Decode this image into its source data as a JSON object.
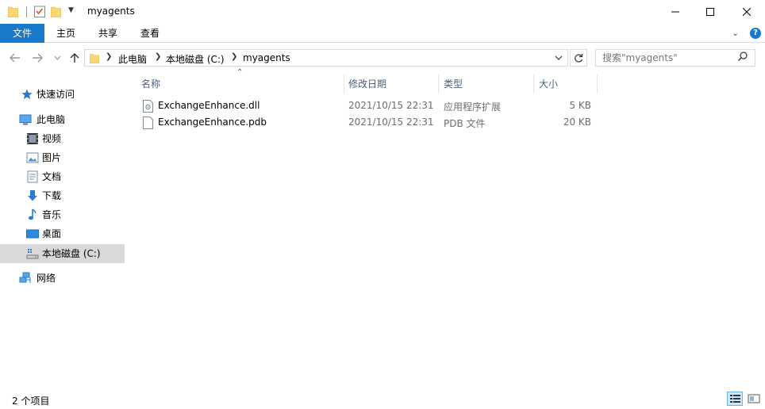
{
  "window": {
    "title": "myagents",
    "min_label": "—",
    "max_label": "☐",
    "close_label": "✕"
  },
  "ribbon": {
    "tabs": [
      "文件",
      "主页",
      "共享",
      "查看"
    ],
    "help_label": "?"
  },
  "address": {
    "breadcrumbs": [
      "此电脑",
      "本地磁盘 (C:)",
      "myagents"
    ],
    "search_placeholder": "搜索\"myagents\""
  },
  "sidebar": {
    "items": [
      {
        "label": "快速访问",
        "icon": "star-icon"
      },
      {
        "label": "此电脑",
        "icon": "computer-icon"
      },
      {
        "label": "视频",
        "icon": "video-icon"
      },
      {
        "label": "图片",
        "icon": "pictures-icon"
      },
      {
        "label": "文档",
        "icon": "documents-icon"
      },
      {
        "label": "下载",
        "icon": "download-icon"
      },
      {
        "label": "音乐",
        "icon": "music-icon"
      },
      {
        "label": "桌面",
        "icon": "desktop-icon"
      },
      {
        "label": "本地磁盘 (C:)",
        "icon": "drive-icon",
        "selected": true
      },
      {
        "label": "网络",
        "icon": "network-icon"
      }
    ]
  },
  "columns": [
    "名称",
    "修改日期",
    "类型",
    "大小"
  ],
  "files": [
    {
      "name": "ExchangeEnhance.dll",
      "date": "2021/10/15 22:31",
      "type": "应用程序扩展",
      "size": "5 KB"
    },
    {
      "name": "ExchangeEnhance.pdb",
      "date": "2021/10/15 22:31",
      "type": "PDB 文件",
      "size": "20 KB"
    }
  ],
  "status": {
    "item_count": "2 个项目"
  },
  "colors": {
    "accent": "#1979ca",
    "selection": "#d9d9d9",
    "header_text": "#4c607a"
  }
}
